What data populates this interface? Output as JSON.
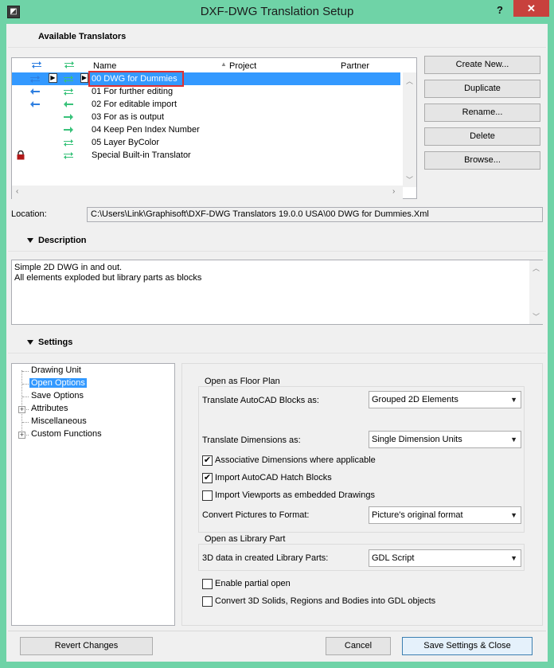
{
  "window": {
    "title": "DXF-DWG Translation Setup",
    "help": "?",
    "close": "✕"
  },
  "available": {
    "header": "Available Translators",
    "columns": {
      "name": "Name",
      "project": "Project",
      "partner": "Partner",
      "sort_glyph": "▲"
    },
    "rows": [
      {
        "name": "00 DWG for Dummies",
        "in": "both",
        "out": "both",
        "selected": true,
        "locked": false
      },
      {
        "name": "01 For further editing",
        "in": "in",
        "out": "both",
        "selected": false,
        "locked": false
      },
      {
        "name": "02 For editable import",
        "in": "in",
        "out": "in",
        "selected": false,
        "locked": false
      },
      {
        "name": "03 For as is output",
        "in": "",
        "out": "out",
        "selected": false,
        "locked": false
      },
      {
        "name": "04 Keep Pen Index Number",
        "in": "",
        "out": "out",
        "selected": false,
        "locked": false
      },
      {
        "name": "05 Layer ByColor",
        "in": "",
        "out": "both",
        "selected": false,
        "locked": false
      },
      {
        "name": "Special Built-in Translator",
        "in": "",
        "out": "both",
        "selected": false,
        "locked": true
      }
    ],
    "buttons": {
      "create_new": "Create New...",
      "duplicate": "Duplicate",
      "rename": "Rename...",
      "delete": "Delete",
      "browse": "Browse..."
    },
    "location_label": "Location:",
    "location_value": "C:\\Users\\Link\\Graphisoft\\DXF-DWG Translators 19.0.0 USA\\00 DWG for Dummies.Xml"
  },
  "description": {
    "header": "Description",
    "line1": "Simple 2D DWG in and out.",
    "line2": "All elements exploded but library parts as blocks"
  },
  "settings": {
    "header": "Settings",
    "tree": [
      {
        "label": "Drawing Unit",
        "selected": false,
        "expandable": false
      },
      {
        "label": "Open Options",
        "selected": true,
        "expandable": false
      },
      {
        "label": "Save Options",
        "selected": false,
        "expandable": false
      },
      {
        "label": "Attributes",
        "selected": false,
        "expandable": true
      },
      {
        "label": "Miscellaneous",
        "selected": false,
        "expandable": false
      },
      {
        "label": "Custom Functions",
        "selected": false,
        "expandable": true
      }
    ],
    "floor_plan": {
      "title": "Open as Floor Plan",
      "blocks_label": "Translate AutoCAD Blocks as:",
      "blocks_value": "Grouped 2D Elements",
      "dims_label": "Translate Dimensions as:",
      "dims_value": "Single Dimension Units",
      "assoc_dims": "Associative Dimensions where applicable",
      "assoc_dims_checked": true,
      "hatch_blocks": "Import AutoCAD Hatch Blocks",
      "hatch_blocks_checked": true,
      "viewports": "Import Viewports as embedded Drawings",
      "viewports_checked": false,
      "pictures_label": "Convert Pictures to Format:",
      "pictures_value": "Picture's original format"
    },
    "library_part": {
      "title": "Open as Library Part",
      "data3d_label": "3D data in created Library Parts:",
      "data3d_value": "GDL Script"
    },
    "partial_open": "Enable partial open",
    "partial_open_checked": false,
    "convert_solids": "Convert 3D Solids, Regions and Bodies into GDL objects",
    "convert_solids_checked": false
  },
  "footer": {
    "revert": "Revert Changes",
    "cancel": "Cancel",
    "save": "Save Settings & Close"
  },
  "colors": {
    "selection": "#3399ff",
    "arrow_blue": "#2f7fe0",
    "arrow_green": "#39c27a",
    "highlight_box": "#e03030",
    "title_bar": "#6fd3a7",
    "close_red": "#c8413d"
  }
}
